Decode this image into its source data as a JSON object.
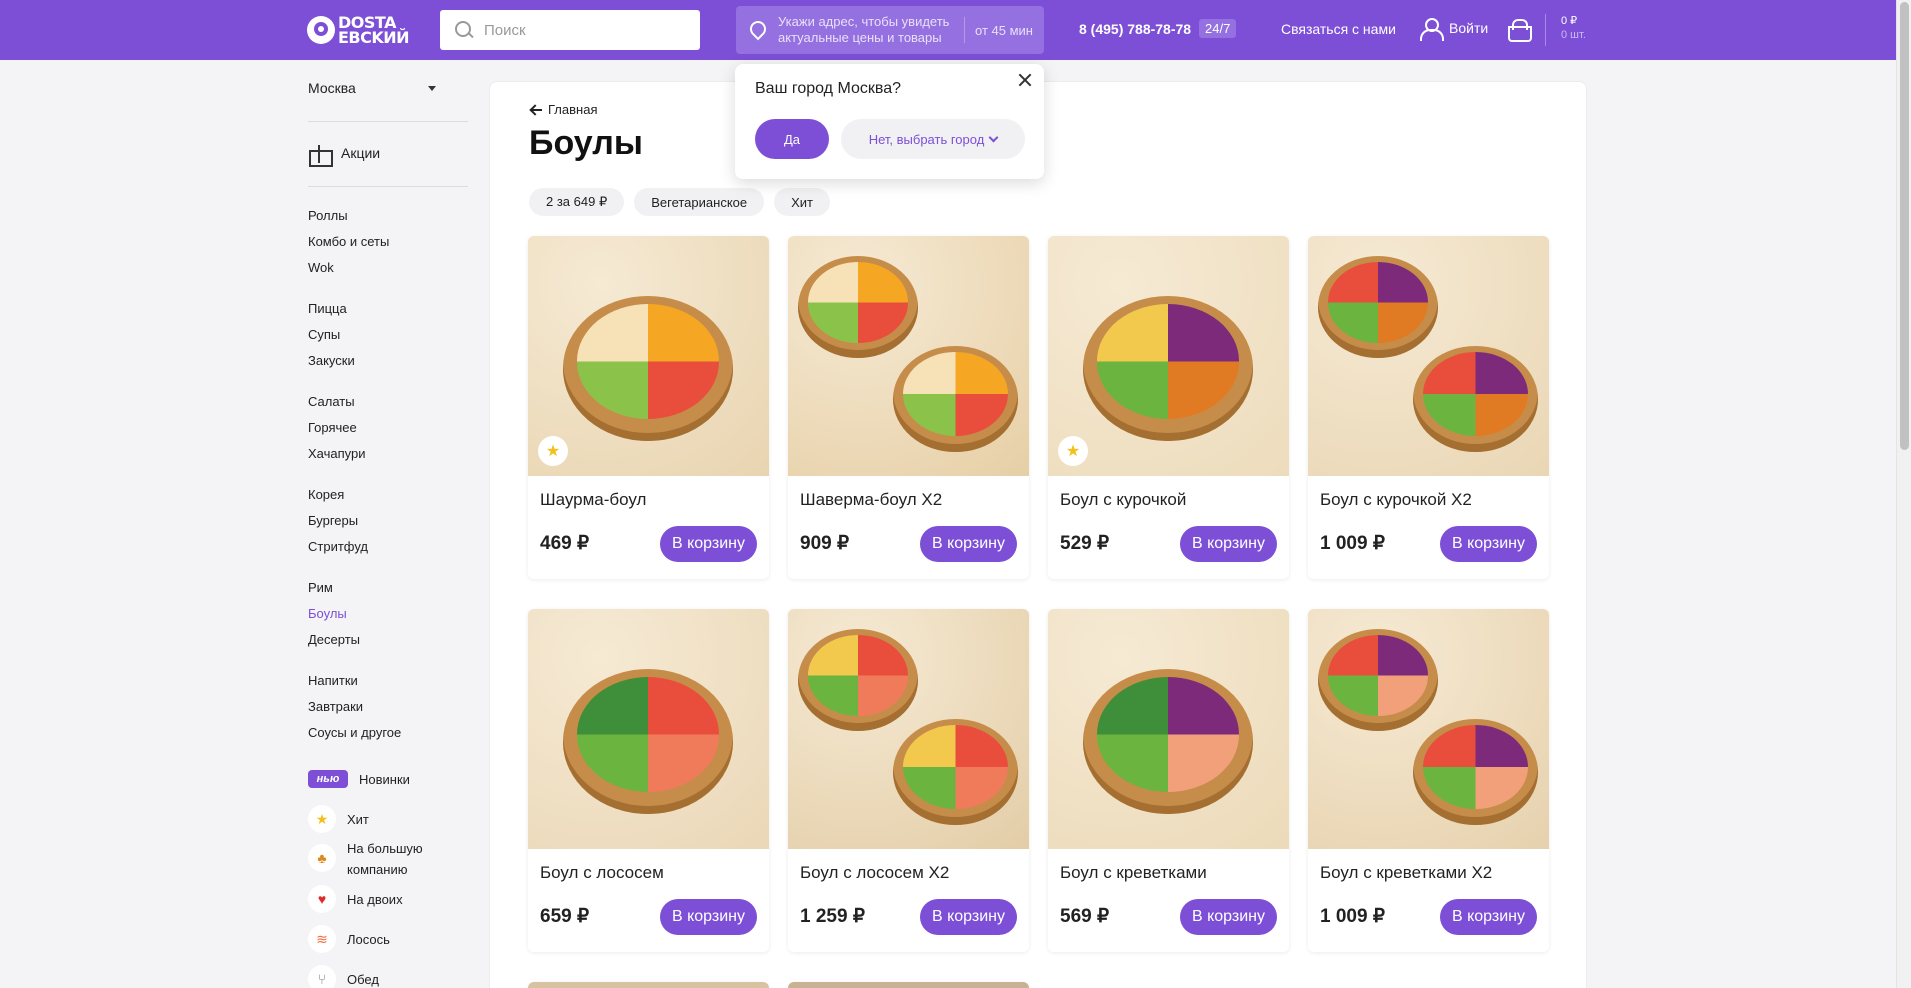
{
  "header": {
    "logo_line1": "DOSTA",
    "logo_line2": "EBCKИЙ",
    "search_placeholder": "Поиск",
    "address_prompt": "Укажи адрес, чтобы увидеть актуальные цены и товары",
    "delivery_time": "от 45 мин",
    "phone": "8 (495) 788-78-78",
    "hours_badge": "24/7",
    "contact_label": "Связаться с нами",
    "login_label": "Войти",
    "cart_sum": "0 ₽",
    "cart_count": "0 шт."
  },
  "sidebar": {
    "city": "Москва",
    "promo_label": "Акции",
    "categories": [
      "Роллы",
      "Комбо и сеты",
      "Wok",
      "Пицца",
      "Супы",
      "Закуски",
      "Салаты",
      "Горячее",
      "Хачапури",
      "Корея",
      "Бургеры",
      "Стритфуд",
      "Рим",
      "Боулы",
      "Десерты",
      "Напитки",
      "Завтраки",
      "Соусы и другое"
    ],
    "active_category": "Боулы",
    "new_badge": "нью",
    "tags": [
      "Новинки",
      "Хит",
      "На большую компанию",
      "На двоих",
      "Лосось",
      "Обед"
    ]
  },
  "main": {
    "breadcrumb": "Главная",
    "title": "Боулы",
    "filters": [
      "2 за 649 ₽",
      "Вегетарианское",
      "Хит"
    ],
    "cart_button_label": "В корзину",
    "products": [
      {
        "name": "Шаурма-боул",
        "price": "469 ₽",
        "hit": true
      },
      {
        "name": "Шаверма-боул X2",
        "price": "909 ₽",
        "hit": false
      },
      {
        "name": "Боул с курочкой",
        "price": "529 ₽",
        "hit": true
      },
      {
        "name": "Боул с курочкой X2",
        "price": "1 009 ₽",
        "hit": false
      },
      {
        "name": "Боул с лососем",
        "price": "659 ₽",
        "hit": false
      },
      {
        "name": "Боул с лососем X2",
        "price": "1 259 ₽",
        "hit": false
      },
      {
        "name": "Боул с креветками",
        "price": "569 ₽",
        "hit": false
      },
      {
        "name": "Боул с креветками X2",
        "price": "1 009 ₽",
        "hit": false
      }
    ]
  },
  "city_popup": {
    "question": "Ваш город Москва?",
    "yes_label": "Да",
    "no_label": "Нет, выбрать город"
  },
  "colors": {
    "brand": "#7c4fd6",
    "active_link": "#7c4fd6"
  }
}
